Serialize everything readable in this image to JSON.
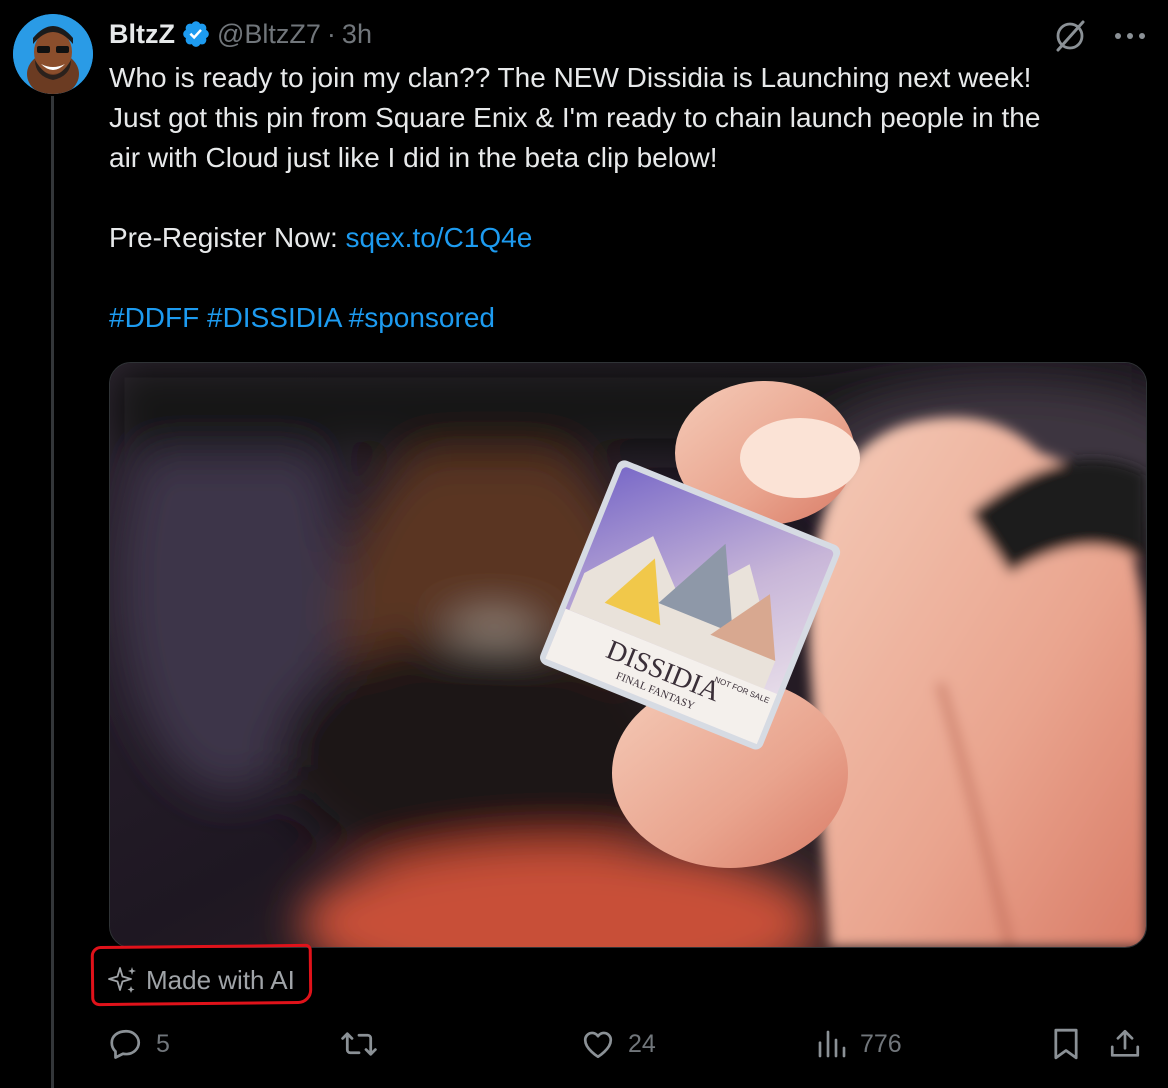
{
  "author": {
    "display_name": "BltzZ",
    "handle": "@BltzZ7",
    "separator": "·",
    "time": "3h"
  },
  "tweet": {
    "line1": "Who is ready to join my clan?? The NEW Dissidia is Launching next week!",
    "line2": "Just got this pin from Square Enix & I'm ready to chain launch people in the",
    "line3": "air with Cloud just like I did in the beta clip below!",
    "register_label": "Pre-Register Now:",
    "register_link": "sqex.to/C1Q4e",
    "hashtags": [
      "#DDFF",
      "#DISSIDIA",
      "#sponsored"
    ]
  },
  "media": {
    "pin_title": "DISSIDIA",
    "pin_subtitle": "FINAL FANTASY",
    "pin_note": "NOT FOR SALE"
  },
  "ai_label": "Made with AI",
  "metrics": {
    "replies": "5",
    "reposts": "",
    "likes": "24",
    "views": "776"
  },
  "colors": {
    "accent": "#1d9bf0",
    "muted": "#71767b",
    "highlight_box": "#e0121a"
  },
  "icons": [
    "verified-badge-icon",
    "grok-icon",
    "more-icon",
    "sparkle-icon",
    "reply-icon",
    "repost-icon",
    "like-icon",
    "views-icon",
    "bookmark-icon",
    "share-icon"
  ]
}
